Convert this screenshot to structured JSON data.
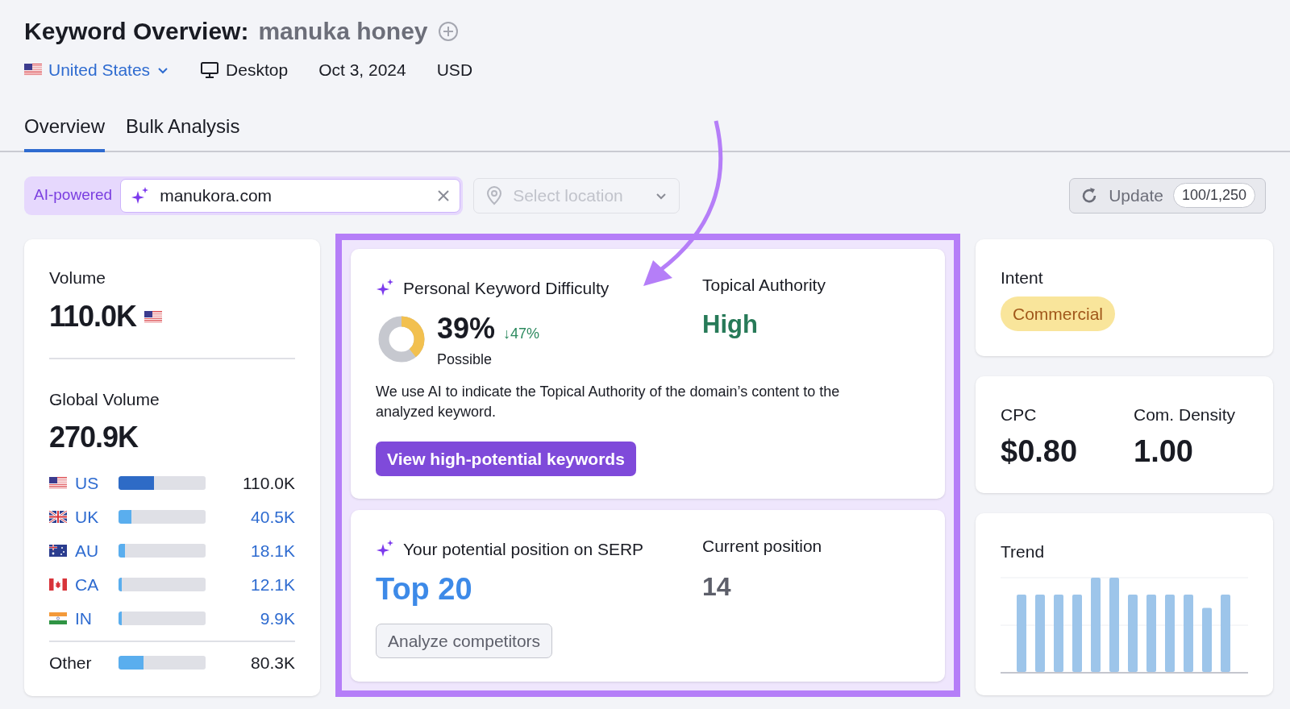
{
  "header": {
    "title": "Keyword Overview:",
    "keyword": "manuka honey"
  },
  "meta": {
    "country": "United States",
    "device": "Desktop",
    "date": "Oct 3, 2024",
    "currency": "USD"
  },
  "tabs": [
    {
      "label": "Overview",
      "selected": true
    },
    {
      "label": "Bulk Analysis",
      "selected": false
    }
  ],
  "toolbar": {
    "ai_badge": "AI-powered",
    "domain": "manukora.com",
    "location_placeholder": "Select location",
    "update": "Update",
    "credits": "100/1,250"
  },
  "volume": {
    "label": "Volume",
    "value": "110.0K",
    "global_label": "Global Volume",
    "global_value": "270.9K",
    "countries": [
      {
        "kind": "us",
        "code": "US",
        "level": 0.41,
        "value": "110.0K",
        "selected": true
      },
      {
        "kind": "uk",
        "code": "UK",
        "level": 0.15,
        "value": "40.5K",
        "selected": false
      },
      {
        "kind": "au",
        "code": "AU",
        "level": 0.07,
        "value": "18.1K",
        "selected": false
      },
      {
        "kind": "ca",
        "code": "CA",
        "level": 0.04,
        "value": "12.1K",
        "selected": false
      },
      {
        "kind": "in",
        "code": "IN",
        "level": 0.04,
        "value": "9.9K",
        "selected": false
      }
    ],
    "other": {
      "label": "Other",
      "level": 0.29,
      "value": "80.3K"
    }
  },
  "difficulty": {
    "label": "Personal Keyword Difficulty",
    "value": "39%",
    "level": 0.39,
    "change": "↓47%",
    "rating": "Possible",
    "authority_label": "Topical Authority",
    "authority": "High",
    "note": "We use AI to indicate the Topical Authority of the domain’s content to the analyzed keyword.",
    "button": "View high-potential keywords"
  },
  "serp": {
    "label": "Your potential position on SERP",
    "value": "Top 20",
    "current_label": "Current position",
    "current": "14",
    "button": "Analyze competitors"
  },
  "intent": {
    "label": "Intent",
    "value": "Commercial"
  },
  "cpc": {
    "label": "CPC",
    "value": "$0.80",
    "density_label": "Com. Density",
    "density": "1.00"
  },
  "trend": {
    "label": "Trend"
  }
}
